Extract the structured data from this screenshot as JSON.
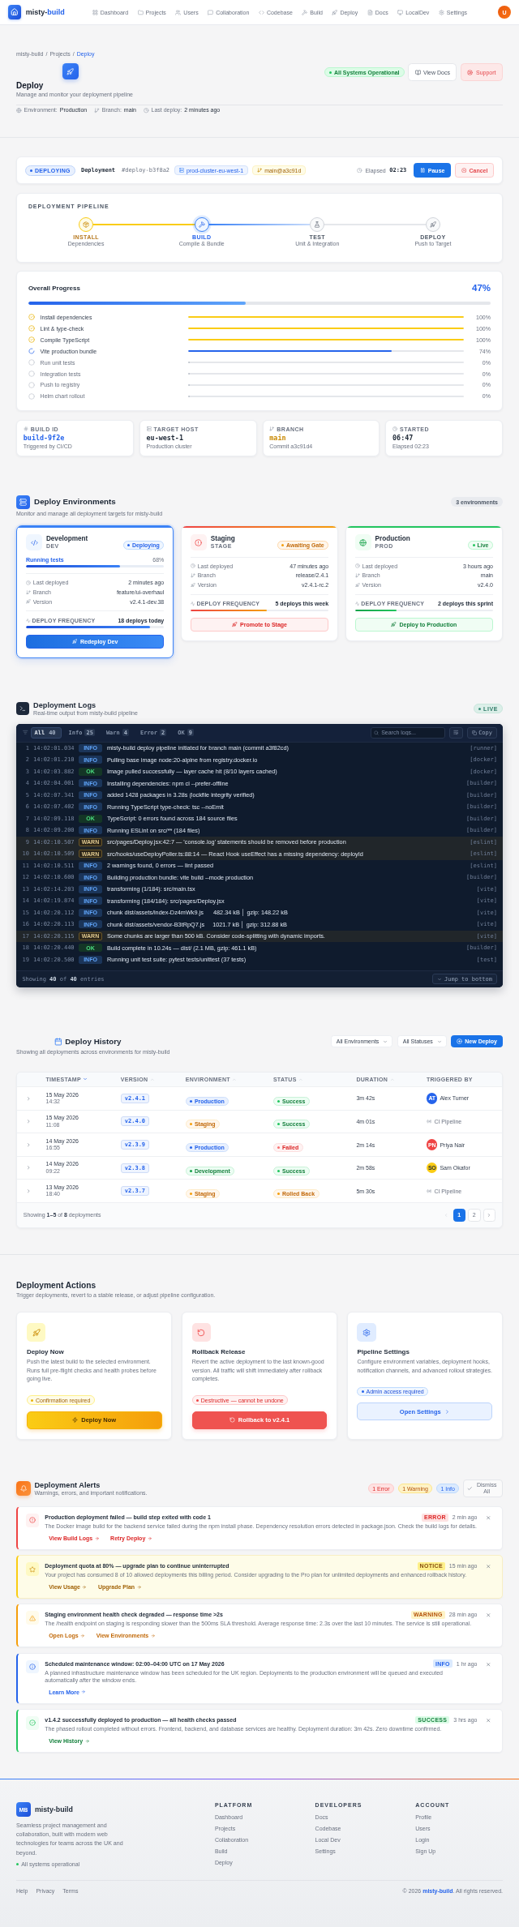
{
  "nav": {
    "brand": {
      "lead": "misty-",
      "accent": "build"
    },
    "items": [
      "Dashboard",
      "Projects",
      "Users",
      "Collaboration",
      "Codebase",
      "Build",
      "Deploy",
      "Docs",
      "LocalDev",
      "Settings"
    ],
    "avatar": "U"
  },
  "breadcrumb": {
    "separator": "/",
    "items": [
      {
        "label": "misty-build",
        "current": false
      },
      {
        "label": "Projects",
        "current": false
      },
      {
        "label": "Deploy",
        "current": true
      }
    ]
  },
  "page": {
    "title": "Deploy",
    "subtitle": "Manage and monitor your deployment pipeline",
    "status": "All Systems Operational",
    "actions": [
      {
        "label": "View Docs",
        "kind": "docs"
      },
      {
        "label": "Support",
        "kind": "support"
      }
    ],
    "meta": [
      {
        "label": "Environment:",
        "value": "Production"
      },
      {
        "label": "Branch:",
        "value": "main"
      },
      {
        "label": "Last deploy:",
        "value": "2 minutes ago"
      }
    ]
  },
  "deployment": {
    "status": "DEPLOYING",
    "label": "Deployment",
    "id": "#deploy-b3f8a2",
    "cluster": "prod-cluster-eu-west-1",
    "ref": "main@a3c91d",
    "elapsed_label": "Elapsed",
    "elapsed": "02:23",
    "buttons": [
      {
        "label": "Pause",
        "kind": "primary"
      },
      {
        "label": "Cancel",
        "kind": "danger"
      }
    ]
  },
  "pipeline": {
    "title": "DEPLOYMENT PIPELINE",
    "steps": [
      {
        "name": "INSTALL",
        "caption": "Dependencies",
        "complete": true,
        "active": false
      },
      {
        "name": "BUILD",
        "caption": "Compile & Bundle",
        "complete": false,
        "active": true
      },
      {
        "name": "TEST",
        "caption": "Unit & Integration",
        "complete": false,
        "active": false
      },
      {
        "name": "DEPLOY",
        "caption": "Push to Target",
        "complete": false,
        "active": false
      }
    ]
  },
  "progress": {
    "title": "Overall Progress",
    "percent": "47%",
    "level": 0.47,
    "tasks": [
      {
        "label": "Install dependencies",
        "complete": true,
        "running": false,
        "percent": "100%",
        "level": 1
      },
      {
        "label": "Lint & type-check",
        "complete": true,
        "running": false,
        "percent": "100%",
        "level": 1
      },
      {
        "label": "Compile TypeScript",
        "complete": true,
        "running": false,
        "percent": "100%",
        "level": 1
      },
      {
        "label": "Vite production bundle",
        "complete": false,
        "running": true,
        "percent": "74%",
        "level": 0.74
      },
      {
        "label": "Run unit tests",
        "complete": false,
        "running": false,
        "percent": "0%",
        "level": 0
      },
      {
        "label": "Integration tests",
        "complete": false,
        "running": false,
        "percent": "0%",
        "level": 0
      },
      {
        "label": "Push to registry",
        "complete": false,
        "running": false,
        "percent": "0%",
        "level": 0
      },
      {
        "label": "Helm chart rollout",
        "complete": false,
        "running": false,
        "percent": "0%",
        "level": 0
      }
    ]
  },
  "stats": [
    {
      "label": "BUILD ID",
      "value": "build-9f2e",
      "note": "Triggered by CI/CD",
      "color": "#2563eb"
    },
    {
      "label": "TARGET HOST",
      "value": "eu-west-1",
      "note": "Production cluster",
      "color": "#1f2937"
    },
    {
      "label": "BRANCH",
      "value": "main",
      "note": "Commit a3c91d4",
      "color": "#ca8a04"
    },
    {
      "label": "STARTED",
      "value": "06:47",
      "note": "Elapsed 02:23",
      "color": "#1f2937"
    }
  ],
  "environments": {
    "title": "Deploy Environments",
    "subtitle": "Monitor and manage all deployment targets for misty-build",
    "count": "3 environments",
    "cards": [
      {
        "kind": "development",
        "name": "Development",
        "code": "DEV",
        "badge": "Deploying",
        "selected": true,
        "activity": {
          "label": "Running tests",
          "percent": "68%",
          "level": 0.68
        },
        "rows": [
          {
            "label": "Last deployed",
            "value": "2 minutes ago"
          },
          {
            "label": "Branch",
            "value": "feature/ui-overhaul"
          },
          {
            "label": "Version",
            "value": "v2.4.1-dev.38"
          }
        ],
        "frequency": {
          "label": "DEPLOY FREQUENCY",
          "value": "18 deploys today",
          "level": 0.9
        },
        "action": "Redeploy Dev"
      },
      {
        "kind": "staging",
        "name": "Staging",
        "code": "STAGE",
        "badge": "Awaiting Gate",
        "selected": false,
        "rows": [
          {
            "label": "Last deployed",
            "value": "47 minutes ago"
          },
          {
            "label": "Branch",
            "value": "release/2.4.1"
          },
          {
            "label": "Version",
            "value": "v2.4.1-rc.2"
          }
        ],
        "frequency": {
          "label": "DEPLOY FREQUENCY",
          "value": "5 deploys this week",
          "level": 0.55
        },
        "action": "Promote to Stage"
      },
      {
        "kind": "production",
        "name": "Production",
        "code": "PROD",
        "badge": "Live",
        "selected": false,
        "rows": [
          {
            "label": "Last deployed",
            "value": "3 hours ago"
          },
          {
            "label": "Branch",
            "value": "main"
          },
          {
            "label": "Version",
            "value": "v2.4.0"
          }
        ],
        "frequency": {
          "label": "DEPLOY FREQUENCY",
          "value": "2 deploys this sprint",
          "level": 0.3
        },
        "action": "Deploy to Production"
      }
    ]
  },
  "logs": {
    "title": "Deployment Logs",
    "subtitle": "Real-time output from misty-build pipeline",
    "live": "LIVE",
    "filters": [
      {
        "label": "All",
        "count": "40",
        "selected": true
      },
      {
        "label": "Info",
        "count": "25",
        "selected": false
      },
      {
        "label": "Warn",
        "count": "4",
        "selected": false
      },
      {
        "label": "Error",
        "count": "2",
        "selected": false
      },
      {
        "label": "OK",
        "count": "9",
        "selected": false
      }
    ],
    "search_placeholder": "Search logs...",
    "copy": "Copy",
    "entries": [
      {
        "line": "1",
        "time": "14:02:01.034",
        "severity": "INFO",
        "message": "misty-build deploy pipeline initiated for branch main (commit a3f82cd)",
        "source": "[runner]"
      },
      {
        "line": "2",
        "time": "14:02:01.210",
        "severity": "INFO",
        "message": "Pulling base image node:20-alpine from registry.docker.io",
        "source": "[docker]"
      },
      {
        "line": "3",
        "time": "14:02:03.882",
        "severity": "OK",
        "message": "Image pulled successfully — layer cache hit (8/10 layers cached)",
        "source": "[docker]"
      },
      {
        "line": "4",
        "time": "14:02:04.001",
        "severity": "INFO",
        "message": "Installing dependencies: npm ci --prefer-offline",
        "source": "[builder]"
      },
      {
        "line": "5",
        "time": "14:02:07.341",
        "severity": "INFO",
        "message": "added 1428 packages in 3.28s (lockfile integrity verified)",
        "source": "[builder]"
      },
      {
        "line": "6",
        "time": "14:02:07.402",
        "severity": "INFO",
        "message": "Running TypeScript type-check: tsc --noEmit",
        "source": "[builder]"
      },
      {
        "line": "7",
        "time": "14:02:09.118",
        "severity": "OK",
        "message": "TypeScript: 0 errors found across 184 source files",
        "source": "[builder]"
      },
      {
        "line": "8",
        "time": "14:02:09.200",
        "severity": "INFO",
        "message": "Running ESLint on src/** (184 files)",
        "source": "[builder]"
      },
      {
        "line": "9",
        "time": "14:02:10.507",
        "severity": "WARN",
        "message": "src/pages/Deploy.jsx:42:7 — 'console.log' statements should be removed before production",
        "source": "[eslint]"
      },
      {
        "line": "10",
        "time": "14:02:10.509",
        "severity": "WARN",
        "message": "src/hooks/useDeployPoller.ts:88:14 — React Hook useEffect has a missing dependency: deployId",
        "source": "[eslint]"
      },
      {
        "line": "11",
        "time": "14:02:10.511",
        "severity": "INFO",
        "message": "2 warnings found, 0 errors — lint passed",
        "source": "[eslint]"
      },
      {
        "line": "12",
        "time": "14:02:10.600",
        "severity": "INFO",
        "message": "Building production bundle: vite build --mode production",
        "source": "[builder]"
      },
      {
        "line": "13",
        "time": "14:02:14.203",
        "severity": "INFO",
        "message": "transforming (1/184): src/main.tsx",
        "source": "[vite]"
      },
      {
        "line": "14",
        "time": "14:02:19.874",
        "severity": "INFO",
        "message": "transforming (184/184): src/pages/Deploy.jsx",
        "source": "[vite]"
      },
      {
        "line": "15",
        "time": "14:02:20.112",
        "severity": "INFO",
        "message": "chunk dist/assets/index-Dz4mWk9.js      482.34 kB │ gzip: 148.22 kB",
        "source": "[vite]"
      },
      {
        "line": "16",
        "time": "14:02:20.113",
        "severity": "INFO",
        "message": "chunk dist/assets/vendor-B3tRpQ7.js     1021.7 kB │ gzip: 312.88 kB",
        "source": "[vite]"
      },
      {
        "line": "17",
        "time": "14:02:20.115",
        "severity": "WARN",
        "message": "Some chunks are larger than 500 kB. Consider code-splitting with dynamic imports.",
        "source": "[vite]"
      },
      {
        "line": "18",
        "time": "14:02:20.440",
        "severity": "OK",
        "message": "Build complete in 10.24s — dist/ (2.1 MB, gzip: 461.1 kB)",
        "source": "[builder]"
      },
      {
        "line": "19",
        "time": "14:02:20.500",
        "severity": "INFO",
        "message": "Running unit test suite: pytest tests/unittest (37 tests)",
        "source": "[test]"
      }
    ],
    "summary": "Showing **40** of **40** entries",
    "jump": "Jump to bottom"
  },
  "history": {
    "title": "Deploy History",
    "subtitle": "Showing all deployments across environments for misty-build",
    "filters": [
      "All Environments",
      "All Statuses"
    ],
    "new_button": "New Deploy",
    "columns": [
      {
        "label": "TIMESTAMP",
        "sortable": true,
        "sorted": true
      },
      {
        "label": "VERSION",
        "sortable": true,
        "sorted": false
      },
      {
        "label": "ENVIRONMENT",
        "sortable": true,
        "sorted": false
      },
      {
        "label": "STATUS",
        "sortable": true,
        "sorted": false
      },
      {
        "label": "DURATION",
        "sortable": true,
        "sorted": false
      },
      {
        "label": "TRIGGERED BY",
        "sortable": false,
        "sorted": false
      }
    ],
    "rows": [
      {
        "date": "15 May 2026",
        "time": "14:32",
        "version": "v2.4.1",
        "environment": {
          "label": "Production",
          "kind": "production"
        },
        "status": {
          "label": "Success",
          "kind": "success"
        },
        "duration": "3m 42s",
        "trigger": {
          "kind": "user",
          "initials": "AT",
          "name": "Alex Turner",
          "color": "#2563eb"
        }
      },
      {
        "date": "15 May 2026",
        "time": "11:08",
        "version": "v2.4.0",
        "environment": {
          "label": "Staging",
          "kind": "staging"
        },
        "status": {
          "label": "Success",
          "kind": "success"
        },
        "duration": "4m 01s",
        "trigger": {
          "kind": "ci",
          "name": "CI Pipeline"
        }
      },
      {
        "date": "14 May 2026",
        "time": "16:55",
        "version": "v2.3.9",
        "environment": {
          "label": "Production",
          "kind": "production"
        },
        "status": {
          "label": "Failed",
          "kind": "failed"
        },
        "duration": "2m 14s",
        "trigger": {
          "kind": "user",
          "initials": "PN",
          "name": "Priya Nair",
          "color": "#ef4444"
        }
      },
      {
        "date": "14 May 2026",
        "time": "09:22",
        "version": "v2.3.8",
        "environment": {
          "label": "Development",
          "kind": "development"
        },
        "status": {
          "label": "Success",
          "kind": "success"
        },
        "duration": "2m 58s",
        "trigger": {
          "kind": "user",
          "initials": "SO",
          "name": "Sam Okafor",
          "color": "#facc15"
        }
      },
      {
        "date": "13 May 2026",
        "time": "18:40",
        "version": "v2.3.7",
        "environment": {
          "label": "Staging",
          "kind": "staging"
        },
        "status": {
          "label": "Rolled Back",
          "kind": "rolled_back"
        },
        "duration": "5m 30s",
        "trigger": {
          "kind": "ci",
          "name": "CI Pipeline"
        }
      }
    ],
    "summary": "Showing **1–5** of **8** deployments",
    "previous_disabled": true,
    "pages": [
      {
        "label": "1",
        "selected": true
      },
      {
        "label": "2",
        "selected": false
      }
    ]
  },
  "actions": {
    "title": "Deployment Actions",
    "subtitle": "Trigger deployments, revert to a stable release, or adjust pipeline configuration.",
    "cards": [
      {
        "kind": "deploy",
        "title": "Deploy Now",
        "text": "Push the latest build to the selected environment. Runs full pre-flight checks and health probes before going live.",
        "note": "Confirmation required",
        "button": "Deploy Now"
      },
      {
        "kind": "rollback",
        "title": "Rollback Release",
        "text": "Revert the active deployment to the last known-good version. All traffic will shift immediately after rollback completes.",
        "note": "Destructive — cannot be undone",
        "button": "Rollback to v2.4.1"
      },
      {
        "kind": "settings",
        "title": "Pipeline Settings",
        "text": "Configure environment variables, deployment hooks, notification channels, and advanced rollout strategies.",
        "note": "Admin access required",
        "button": "Open Settings"
      }
    ]
  },
  "alerts": {
    "title": "Deployment Alerts",
    "subtitle": "Warnings, errors, and important notifications.",
    "counts": [
      {
        "label": "1 Error",
        "kind": "error"
      },
      {
        "label": "1 Warning",
        "kind": "warning"
      },
      {
        "label": "1 Info",
        "kind": "info"
      }
    ],
    "dismiss": "Dismiss All",
    "items": [
      {
        "kind": "error",
        "title": "Production deployment failed — build step exited with code 1",
        "tag": "ERROR",
        "time": "2 min ago",
        "text": "The Docker image build for the backend service failed during the npm install phase. Dependency resolution errors detected in package.json. Check the build logs for details.",
        "links": [
          "View Build Logs",
          "Retry Deploy"
        ]
      },
      {
        "kind": "notice",
        "title": "Deployment quota at 80% — upgrade plan to continue uninterrupted",
        "tag": "NOTICE",
        "time": "15 min ago",
        "text": "Your project has consumed 8 of 10 allowed deployments this billing period. Consider upgrading to the Pro plan for unlimited deployments and enhanced rollback history.",
        "links": [
          "View Usage",
          "Upgrade Plan"
        ]
      },
      {
        "kind": "warning",
        "title": "Staging environment health check degraded — response time >2s",
        "tag": "WARNING",
        "time": "28 min ago",
        "text": "The /health endpoint on staging is responding slower than the 500ms SLA threshold. Average response time: 2.3s over the last 10 minutes. The service is still operational.",
        "links": [
          "Open Logs",
          "View Environments"
        ]
      },
      {
        "kind": "info",
        "title": "Scheduled maintenance window: 02:00–04:00 UTC on 17 May 2026",
        "tag": "INFO",
        "time": "1 hr ago",
        "text": "A planned infrastructure maintenance window has been scheduled for the UK region. Deployments to the production environment will be queued and executed automatically after the window ends.",
        "links": [
          "Learn More"
        ]
      },
      {
        "kind": "success",
        "title": "v1.4.2 successfully deployed to production — all health checks passed",
        "tag": "SUCCESS",
        "time": "3 hrs ago",
        "text": "The phased rollout completed without errors. Frontend, backend, and database services are healthy. Deployment duration: 3m 42s. Zero downtime confirmed.",
        "links": [
          "View History"
        ]
      }
    ]
  },
  "footer": {
    "logo": "MB",
    "brand": "misty-build",
    "about": "Seamless project management and collaboration, built with modern web technologies for teams across the UK and beyond.",
    "status": "All systems operational",
    "columns": [
      {
        "title": "PLATFORM",
        "links": [
          "Dashboard",
          "Projects",
          "Collaboration",
          "Build",
          "Deploy"
        ]
      },
      {
        "title": "DEVELOPERS",
        "links": [
          "Docs",
          "Codebase",
          "Local Dev",
          "Settings"
        ]
      },
      {
        "title": "ACCOUNT",
        "links": [
          "Profile",
          "Users",
          "Login",
          "Sign Up"
        ]
      }
    ],
    "legal": [
      "Help",
      "Privacy",
      "Terms"
    ],
    "copyright": "© 2026 **misty-build**. All rights reserved."
  }
}
